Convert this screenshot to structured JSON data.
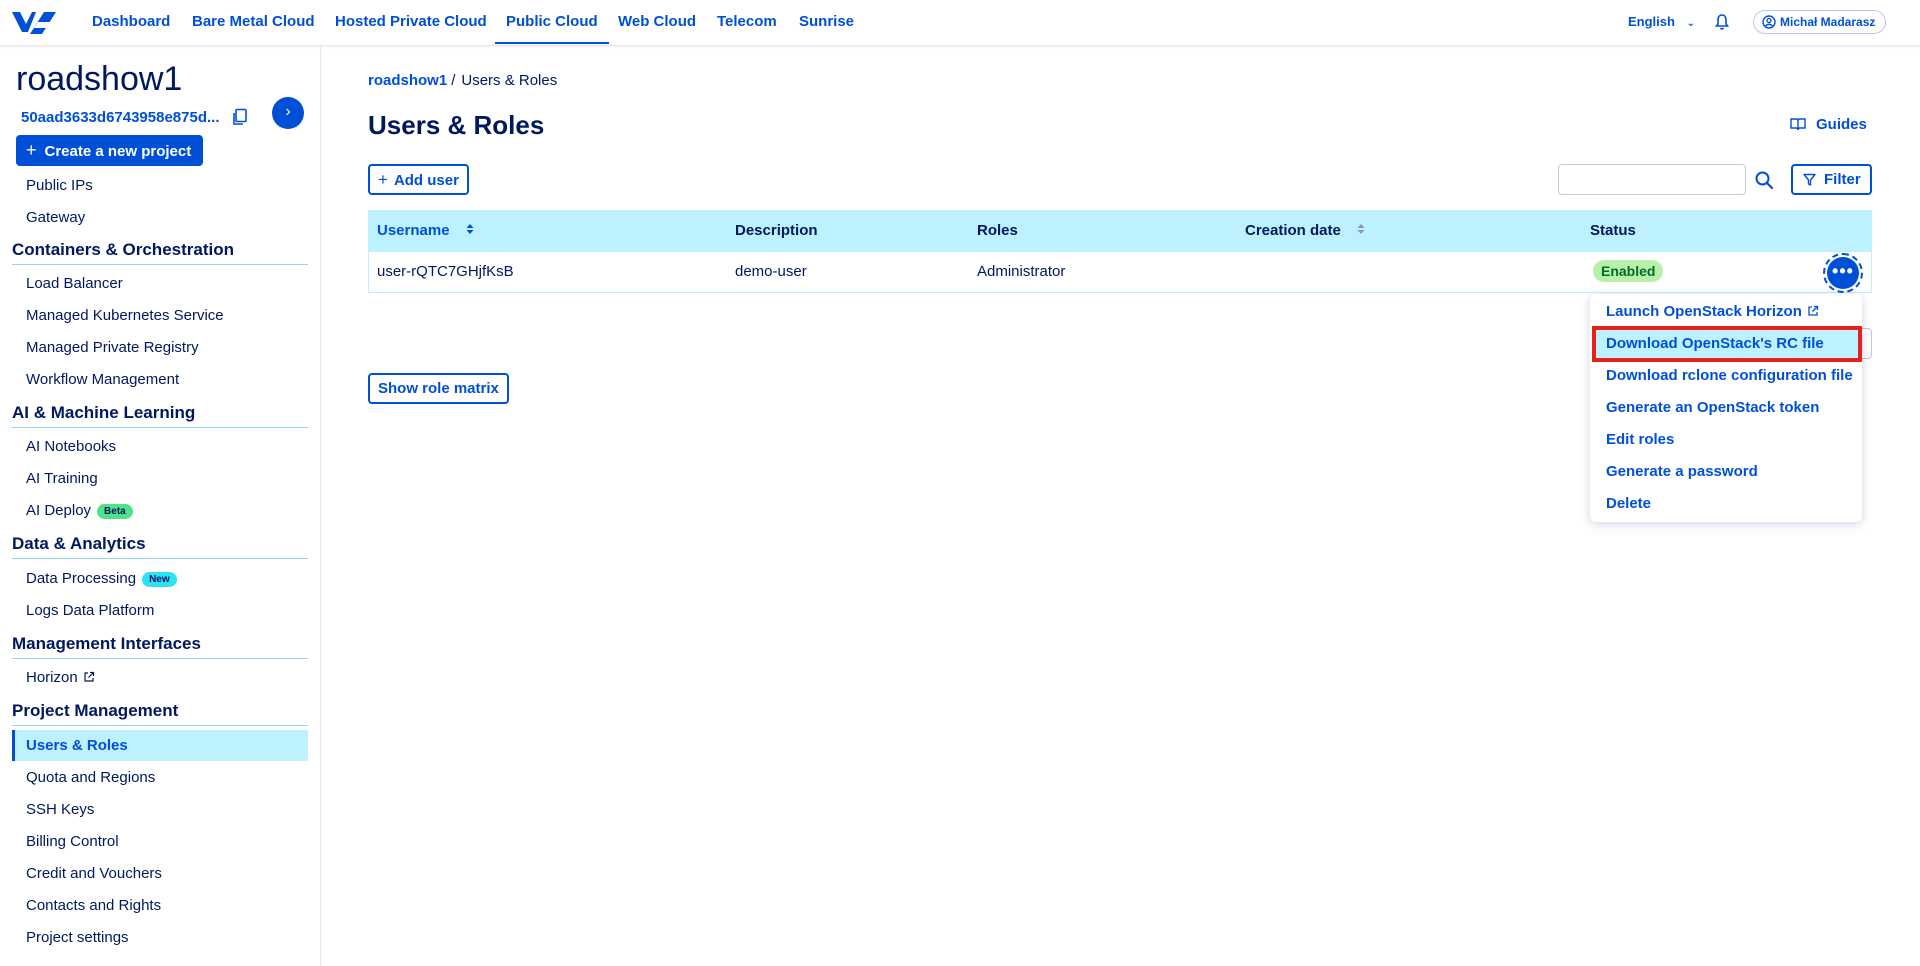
{
  "topnav": {
    "items": [
      "Dashboard",
      "Bare Metal Cloud",
      "Hosted Private Cloud",
      "Public Cloud",
      "Web Cloud",
      "Telecom",
      "Sunrise"
    ],
    "active": "Public Cloud",
    "language": "English",
    "user_name": "Michał Madarasz"
  },
  "sidebar": {
    "project_name": "roadshow1",
    "project_id": "50aad3633d6743958e875d...",
    "create_project_label": "Create a new project",
    "items_top": [
      "Public IPs",
      "Gateway"
    ],
    "sections": [
      {
        "title": "Containers & Orchestration",
        "items": [
          "Load Balancer",
          "Managed Kubernetes Service",
          "Managed Private Registry",
          "Workflow Management"
        ]
      },
      {
        "title": "AI & Machine Learning",
        "items": [
          "AI Notebooks",
          "AI Training",
          "AI Deploy"
        ]
      },
      {
        "title": "Data & Analytics",
        "items": [
          "Data Processing",
          "Logs Data Platform"
        ]
      },
      {
        "title": "Management Interfaces",
        "items": [
          "Horizon"
        ]
      },
      {
        "title": "Project Management",
        "items": [
          "Users & Roles",
          "Quota and Regions",
          "SSH Keys",
          "Billing Control",
          "Credit and Vouchers",
          "Contacts and Rights",
          "Project settings"
        ]
      }
    ],
    "badges": {
      "ai_deploy": "Beta",
      "data_processing": "New"
    },
    "active_item": "Users & Roles"
  },
  "main": {
    "breadcrumb": {
      "link": "roadshow1",
      "separator": "/",
      "current": "Users & Roles"
    },
    "title": "Users & Roles",
    "guides_label": "Guides",
    "add_user_label": "Add user",
    "search_value": "",
    "filter_label": "Filter",
    "table": {
      "columns": [
        "Username",
        "Description",
        "Roles",
        "Creation date",
        "Status"
      ],
      "rows": [
        {
          "username": "user-rQTC7GHjfKsB",
          "description": "demo-user",
          "roles": "Administrator",
          "creation_date": "",
          "status": "Enabled"
        }
      ]
    },
    "show_role_matrix_label": "Show role matrix"
  },
  "action_menu": {
    "items": [
      "Launch OpenStack Horizon",
      "Download OpenStack's RC file",
      "Download rclone configuration file",
      "Generate an OpenStack token",
      "Edit roles",
      "Generate a password",
      "Delete"
    ],
    "highlighted": "Download OpenStack's RC file"
  },
  "colors": {
    "primary": "#0050d7",
    "text": "#00185e",
    "header_bg": "#bef1ff",
    "highlight_border": "#e6201c",
    "status_bg": "#b9f0a9"
  }
}
